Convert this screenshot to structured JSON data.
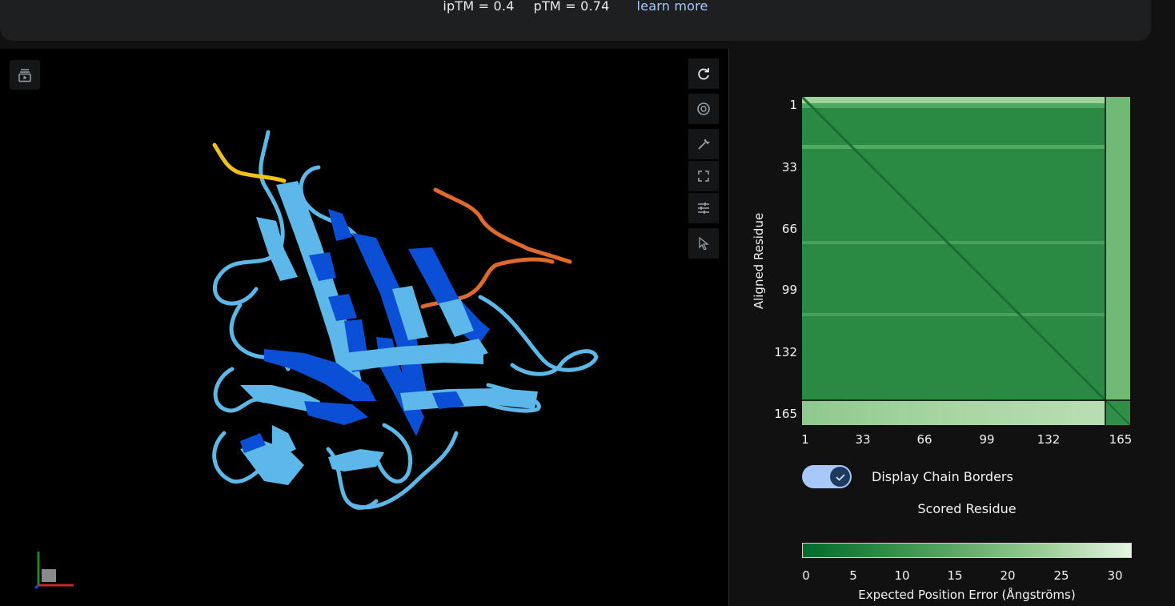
{
  "header": {
    "iptm_text": "ipTM = 0.4",
    "ptm_text": "pTM = 0.74",
    "learn_more": "learn more"
  },
  "viewer": {
    "left_tool_icon": "playlist-play-icon",
    "toolbar_icons": [
      "rotate-icon",
      "camera-shutter-icon",
      "wrench-icon",
      "fullscreen-icon",
      "sliders-icon",
      "cursor-icon"
    ],
    "chain_colors": {
      "main": "#5bb8e8",
      "high_confidence": "#0a4fd6",
      "ligand_yellow": "#f2c316",
      "ligand_orange": "#e06a2e"
    }
  },
  "pae_plot": {
    "y_axis_label": "Aligned Residue",
    "x_axis_label": "Scored Residue",
    "y_ticks": [
      "1",
      "33",
      "66",
      "99",
      "132",
      "165"
    ],
    "x_ticks": [
      "1",
      "33",
      "66",
      "99",
      "132",
      "165"
    ],
    "toggle_label": "Display Chain Borders",
    "toggle_on": true,
    "colorbar_ticks": [
      "0",
      "5",
      "10",
      "15",
      "20",
      "25",
      "30"
    ],
    "colorbar_label": "Expected Position Error (Ångströms)",
    "colors": {
      "low": "#006b2a",
      "high": "#e6f5e3"
    }
  }
}
